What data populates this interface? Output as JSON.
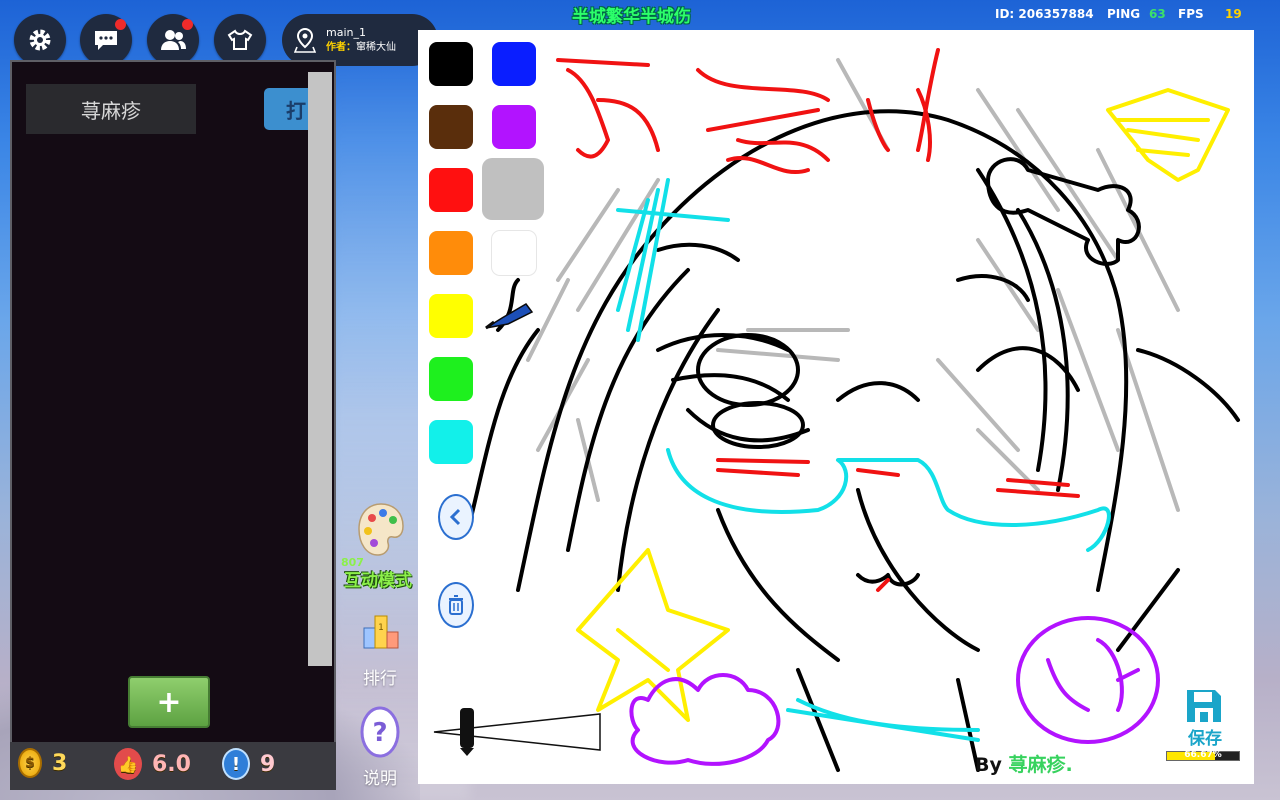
{
  "header": {
    "map_name": "main_1",
    "author_label": "作者：",
    "author_name": "窜稀大仙",
    "world_title": "半城繁华半城伤",
    "id_text": "ID: 206357884",
    "ping_label": "PING",
    "ping_value": "63",
    "fps_label": "FPS",
    "fps_value": "19"
  },
  "toolbar_icons": [
    "gear-icon",
    "chat-icon",
    "friends-icon",
    "wardrobe-icon",
    "map-pin-icon"
  ],
  "left_panel": {
    "name_box": "荨麻疹",
    "print_button": "打",
    "add_button": "+"
  },
  "bottom_stats": {
    "coins": "3",
    "likes": "6.0",
    "reports": "9"
  },
  "side_menu": {
    "interactive_count": "807",
    "interactive_mode": "互动模式",
    "ranking": "排行",
    "help": "说明"
  },
  "canvas": {
    "colors": [
      {
        "name": "black",
        "hex": "#000000"
      },
      {
        "name": "blue",
        "hex": "#0a1eff"
      },
      {
        "name": "brown",
        "hex": "#5a2e0c"
      },
      {
        "name": "purple",
        "hex": "#b213ff"
      },
      {
        "name": "red",
        "hex": "#ff1010"
      },
      {
        "name": "gray",
        "hex": "#c0c0c0",
        "selected": true
      },
      {
        "name": "orange",
        "hex": "#ff8c0a"
      },
      {
        "name": "white",
        "hex": "#ffffff"
      },
      {
        "name": "yellow",
        "hex": "#ffff00"
      },
      {
        "name": "green",
        "hex": "#1ef01e"
      },
      {
        "name": "cyan",
        "hex": "#12f0ea"
      }
    ],
    "save_label": "保存",
    "progress_percent": 66.67,
    "progress_text": "66.67%",
    "byline_prefix": "By",
    "byline_name": "荨麻疹."
  }
}
